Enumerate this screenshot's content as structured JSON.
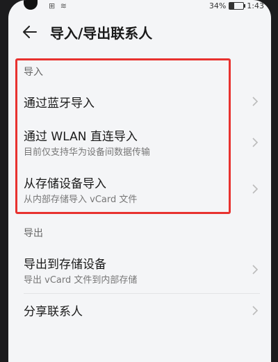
{
  "status_bar": {
    "left_icons": "⊞ ≋",
    "battery_percent": "34%",
    "battery_level": 0.34,
    "time": "1:43"
  },
  "header": {
    "back_icon": "back-arrow-icon",
    "title": "导入/导出联系人"
  },
  "import_section": {
    "label": "导入",
    "items": [
      {
        "title": "通过蓝牙导入",
        "subtitle": ""
      },
      {
        "title": "通过 WLAN 直连导入",
        "subtitle": "目前仅支持华为设备间数据传输"
      },
      {
        "title": "从存储设备导入",
        "subtitle": "从内部存储导入 vCard 文件"
      }
    ]
  },
  "export_section": {
    "label": "导出",
    "items": [
      {
        "title": "导出到存储设备",
        "subtitle": "导出 vCard 文件到内部存储"
      },
      {
        "title": "分享联系人",
        "subtitle": ""
      }
    ]
  },
  "colors": {
    "highlight": "#e8322f",
    "background": "#f4f5f7",
    "text": "#1a1a1a"
  }
}
